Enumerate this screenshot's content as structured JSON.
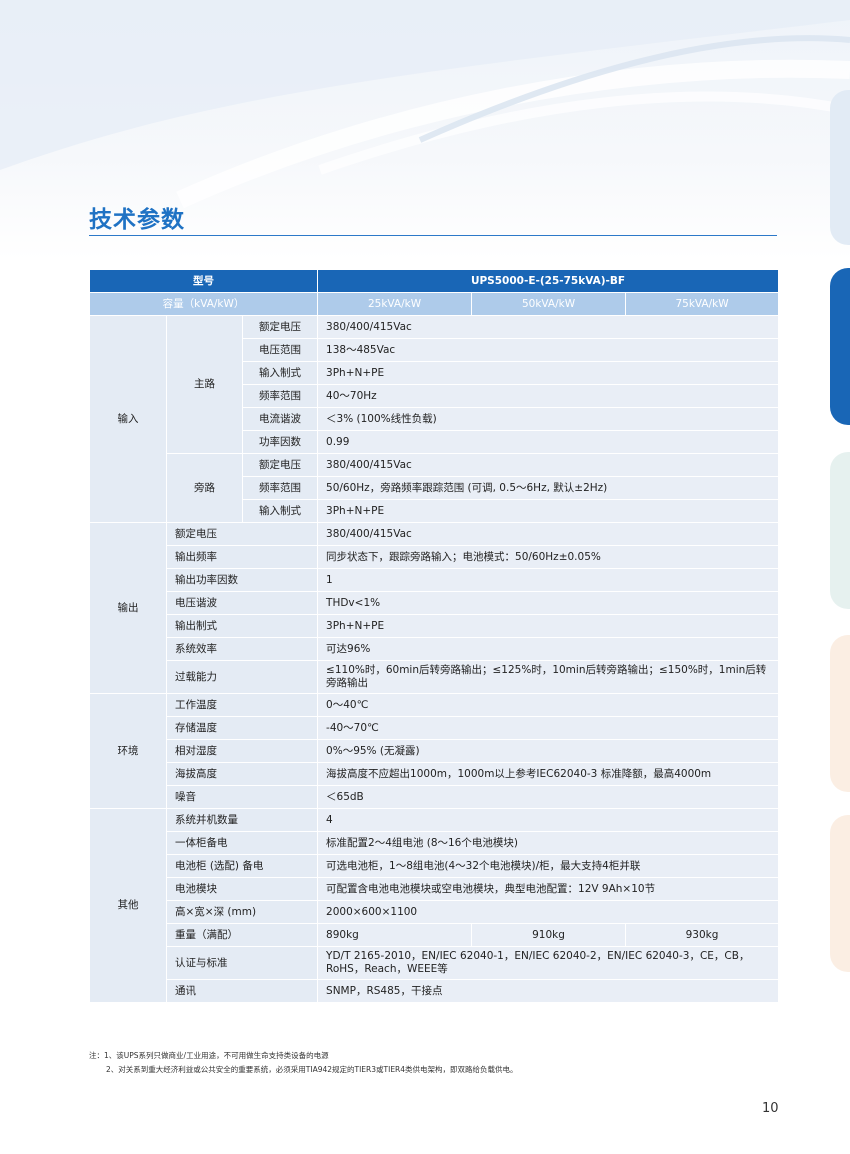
{
  "title": "技术参数",
  "colors": {
    "accent": "#1f72c4",
    "header_bg": "#1966b6",
    "subheader_bg": "#aecbea",
    "cell_bg": "#e4ebf4"
  },
  "header": {
    "model_label": "型号",
    "model_value": "UPS5000-E-(25-75kVA)-BF",
    "capacity_label": "容量（kVA/kW）",
    "capacities": [
      "25kVA/kW",
      "50kVA/kW",
      "75kVA/kW"
    ]
  },
  "input": {
    "label": "输入",
    "main_label": "主路",
    "main": [
      {
        "param": "额定电压",
        "value": "380/400/415Vac"
      },
      {
        "param": "电压范围",
        "value": "138～485Vac"
      },
      {
        "param": "输入制式",
        "value": "3Ph+N+PE"
      },
      {
        "param": "频率范围",
        "value": "40～70Hz"
      },
      {
        "param": "电流谐波",
        "value": "＜3% (100%线性负载)"
      },
      {
        "param": "功率因数",
        "value": "0.99"
      }
    ],
    "bypass_label": "旁路",
    "bypass": [
      {
        "param": "额定电压",
        "value": "380/400/415Vac"
      },
      {
        "param": "频率范围",
        "value": "50/60Hz，旁路频率跟踪范围 (可调, 0.5～6Hz, 默认±2Hz)"
      },
      {
        "param": "输入制式",
        "value": "3Ph+N+PE"
      }
    ]
  },
  "output": {
    "label": "输出",
    "rows": [
      {
        "param": "额定电压",
        "value": "380/400/415Vac"
      },
      {
        "param": "输出频率",
        "value": "同步状态下，跟踪旁路输入；电池模式：50/60Hz±0.05%"
      },
      {
        "param": "输出功率因数",
        "value": "1"
      },
      {
        "param": "电压谐波",
        "value": "THDv<1%"
      },
      {
        "param": "输出制式",
        "value": "3Ph+N+PE"
      },
      {
        "param": "系统效率",
        "value": "可达96%"
      },
      {
        "param": "过载能力",
        "value": "≤110%时，60min后转旁路输出；≤125%时，10min后转旁路输出；≤150%时，1min后转旁路输出"
      }
    ]
  },
  "environment": {
    "label": "环境",
    "rows": [
      {
        "param": "工作温度",
        "value": "0～40℃"
      },
      {
        "param": "存储温度",
        "value": "-40～70℃"
      },
      {
        "param": "相对湿度",
        "value": "0%～95% (无凝露)"
      },
      {
        "param": "海拔高度",
        "value": "海拔高度不应超出1000m，1000m以上参考IEC62040-3 标准降额，最高4000m"
      },
      {
        "param": "噪音",
        "value": "＜65dB"
      }
    ]
  },
  "other": {
    "label": "其他",
    "rows": [
      {
        "param": "系统并机数量",
        "value": "4"
      },
      {
        "param": "一体柜备电",
        "value": "标准配置2～4组电池 (8～16个电池模块)"
      },
      {
        "param": "电池柜 (选配) 备电",
        "value": "可选电池柜，1～8组电池(4～32个电池模块)/柜，最大支持4柜并联"
      },
      {
        "param": "电池模块",
        "value": "可配置含电池电池模块或空电池模块，典型电池配置：12V 9Ah×10节"
      },
      {
        "param": "高×宽×深 (mm)",
        "value": "2000×600×1100"
      }
    ],
    "weight_label": "重量（满配）",
    "weights": [
      "890kg",
      "910kg",
      "930kg"
    ],
    "cert_label": "认证与标准",
    "cert_value": "YD/T 2165-2010，EN/IEC 62040-1，EN/IEC 62040-2，EN/IEC 62040-3，CE，CB，RoHS，Reach，WEEE等",
    "comm_label": "通讯",
    "comm_value": "SNMP，RS485，干接点"
  },
  "notes": {
    "line1": "注：1、该UPS系列只做商业/工业用途，不可用做生命支持类设备的电源",
    "line2": "2、对关系到重大经济利益或公共安全的重要系统，必须采用TIA942规定的TIER3或TIER4类供电架构，即双路给负载供电。"
  },
  "page_number": "10"
}
